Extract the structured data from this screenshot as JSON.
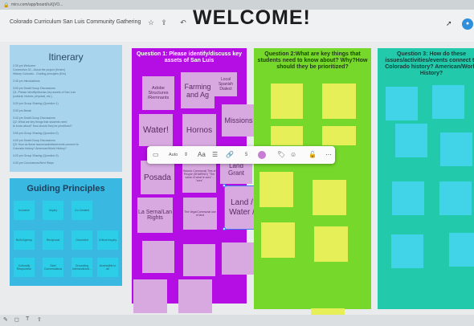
{
  "browser": {
    "url": "miro.com/app/board/uXjVO..."
  },
  "board": {
    "title": "Colorado Curriculum San Luis Community Gathering",
    "icons": [
      "star-icon",
      "upload-icon",
      "undo-icon"
    ],
    "welcome": "WELCOME!"
  },
  "itinerary": {
    "title": "Itinerary",
    "lines": [
      "2:30 pm Welcome",
      "Connection 30 - About the project (Kristin)",
      "History Colorado - Guiding principles (Eric)",
      "2:45 pm Introductions",
      "3:00 pm Small Group Discussions",
      "Q1: Please identify/discuss key assets of San Luis",
      "(cultural, historic, physical, etc.)",
      "3:20 pm Group Sharing (Question 1)",
      "3:30 pm Break",
      "3:40 pm Small Group Discussions",
      "Q2: What are key things that students need",
      "to know about? How should they be prioritized?",
      "3:55 pm Group Sharing (Question 2)",
      "4:00 pm Small Group Discussions",
      "Q3: How do these issues/activities/events connect to",
      "Colorado history? American/World History?",
      "4:20 pm Group Sharing (Question 3)",
      "4:30 pm Conclusions/Next Steps"
    ]
  },
  "guiding": {
    "title": "Guiding Principles",
    "stickies": [
      "Inclusive",
      "Inquiry",
      "Co-Created",
      "Build Agency",
      "Reciprocal",
      "Grounded",
      "Critical Inquiry",
      "Culturally Responsive",
      "Start Conversations",
      "Grounding Intersectional...",
      "Accessible to all"
    ]
  },
  "q1": {
    "title": "Question 1: Please identify/discuss key assets of San Luis",
    "stickies": [
      "Adobe Structures /Remnants",
      "Farming and Ag",
      "Local Spanish Dialect",
      "Water!",
      "Hornos",
      "Missions",
      "Posada",
      "Historic Communal Ties of People (SHARING) \"The value of what is ours\" - \"ours\"",
      "Land Grant",
      "La Serna/Lan Rights",
      "The Vega/Communal use of land"
    ],
    "selected": "Land / Water /"
  },
  "q2": {
    "title": "Question 2:What are key things that students need to know about? Why?How should they be prioritized?"
  },
  "q3": {
    "title": "Question 3: How do these issues/activities/events connect to Colorado history? American/World History?"
  },
  "toolbar": {
    "font_label": "Auto",
    "text_size_label": "Aa",
    "number_label": "5",
    "icons": [
      "sticky-note-icon",
      "align-icon",
      "link-icon",
      "color-icon",
      "tag-icon",
      "emoji-icon",
      "lock-icon",
      "more-icon"
    ],
    "color": "#c77dd4"
  },
  "colors": {
    "purple": "#b50ee4",
    "green": "#76d82a",
    "teal": "#22c9ab",
    "blue": "#39b8e2",
    "light_blue": "#a8d4ee"
  }
}
